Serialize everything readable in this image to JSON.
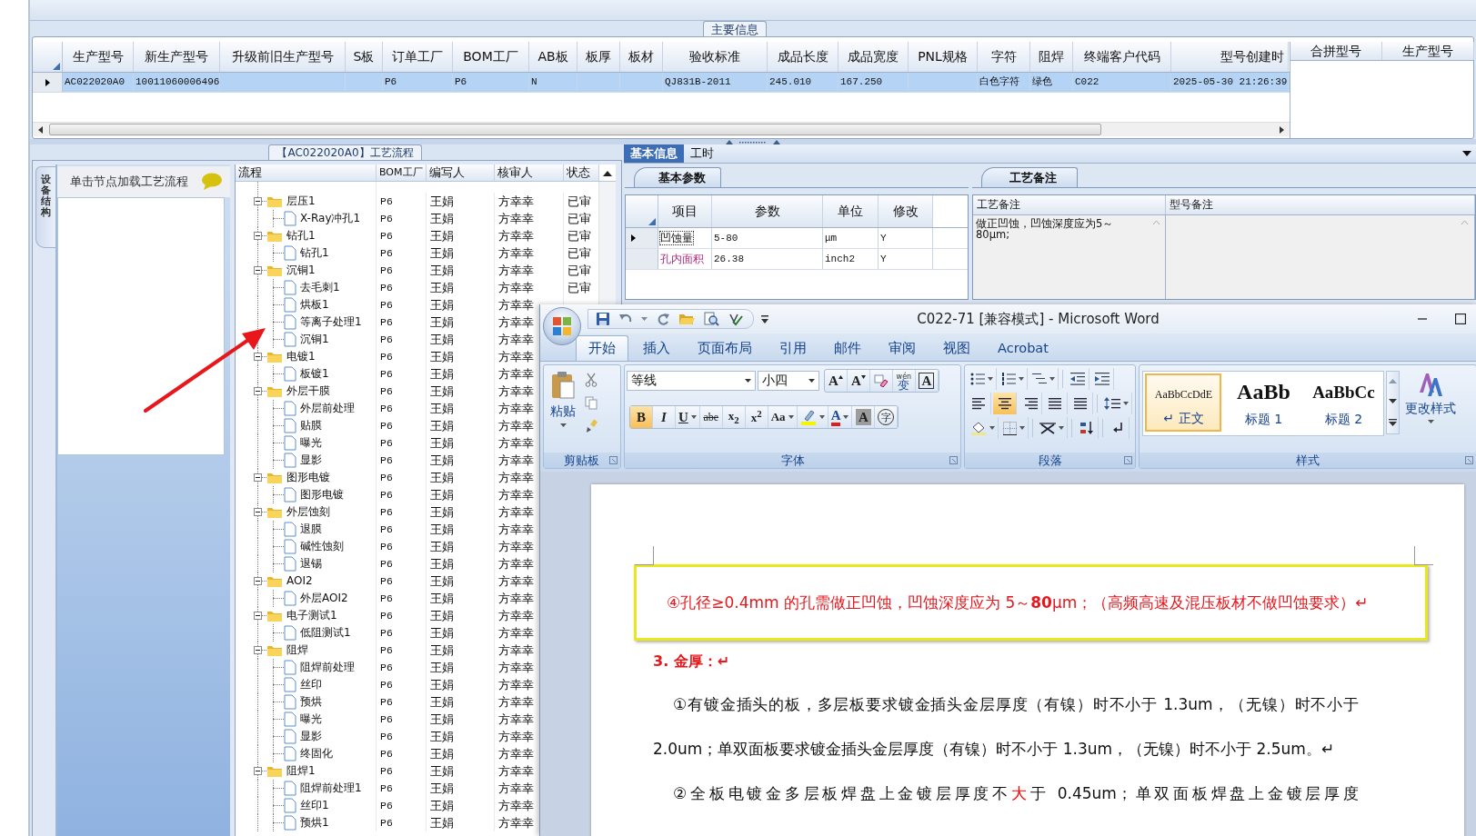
{
  "info_group": {
    "title": "主要信息",
    "row_selected": true,
    "columns": [
      {
        "label": "生产型号",
        "value": "AC022020A0"
      },
      {
        "label": "新生产型号",
        "value": "10011060006496"
      },
      {
        "label": "升级前旧生产型号"
      },
      {
        "label": "S板"
      },
      {
        "label": "订单工厂",
        "value": "P6"
      },
      {
        "label": "BOM工厂",
        "value": "P6"
      },
      {
        "label": "AB板",
        "value": "N"
      },
      {
        "label": "板厚"
      },
      {
        "label": "板材"
      },
      {
        "label": "验收标准",
        "value": "QJ831B-2011"
      },
      {
        "label": "成品长度",
        "value": "245.010"
      },
      {
        "label": "成品宽度",
        "value": "167.250"
      },
      {
        "label": "PNL规格"
      },
      {
        "label": "字符",
        "value": "白色字符"
      },
      {
        "label": "阻焊",
        "value": "绿色"
      },
      {
        "label": "终端客户代码",
        "value": "C022"
      },
      {
        "label": "型号创建时",
        "value": "2025-05-30 21:26:39"
      }
    ],
    "side_columns": [
      "合拼型号",
      "生产型号"
    ]
  },
  "flow": {
    "title": "【AC022020A0】工艺流程",
    "side_tab": "设备结构",
    "hint": "单击节点加载工艺流程",
    "columns": [
      "流程",
      "BOM工厂",
      "编写人",
      "核审人",
      "状态"
    ],
    "rows": [
      {
        "name": "层压1",
        "expanded": true,
        "bom": "P6",
        "writer": "王娟",
        "reviewer": "方幸幸",
        "status": "已审",
        "children": [
          {
            "name": "X-Ray冲孔1",
            "bom": "P6",
            "writer": "王娟",
            "reviewer": "方幸幸",
            "status": "已审"
          }
        ]
      },
      {
        "name": "钻孔1",
        "expanded": true,
        "bom": "P6",
        "writer": "王娟",
        "reviewer": "方幸幸",
        "status": "已审",
        "children": [
          {
            "name": "钻孔1",
            "bom": "P6",
            "writer": "王娟",
            "reviewer": "方幸幸",
            "status": "已审"
          }
        ]
      },
      {
        "name": "沉铜1",
        "expanded": true,
        "bom": "P6",
        "writer": "王娟",
        "reviewer": "方幸幸",
        "status": "已审",
        "children": [
          {
            "name": "去毛刺1",
            "bom": "P6",
            "writer": "王娟",
            "reviewer": "方幸幸",
            "status": "已审"
          },
          {
            "name": "烘板1",
            "bom": "P6",
            "writer": "王娟",
            "reviewer": "方幸幸"
          },
          {
            "name": "等离子处理1",
            "bom": "P6",
            "writer": "王娟",
            "reviewer": "方幸幸"
          },
          {
            "name": "沉铜1",
            "bom": "P6",
            "writer": "王娟",
            "reviewer": "方幸幸"
          }
        ]
      },
      {
        "name": "电镀1",
        "expanded": true,
        "bom": "P6",
        "writer": "王娟",
        "reviewer": "方幸幸",
        "children": [
          {
            "name": "板镀1",
            "bom": "P6",
            "writer": "王娟",
            "reviewer": "方幸幸"
          }
        ]
      },
      {
        "name": "外层干膜",
        "expanded": true,
        "bom": "P6",
        "writer": "王娟",
        "reviewer": "方幸幸",
        "children": [
          {
            "name": "外层前处理",
            "bom": "P6",
            "writer": "王娟",
            "reviewer": "方幸幸"
          },
          {
            "name": "贴膜",
            "bom": "P6",
            "writer": "王娟",
            "reviewer": "方幸幸"
          },
          {
            "name": "曝光",
            "bom": "P6",
            "writer": "王娟",
            "reviewer": "方幸幸"
          },
          {
            "name": "显影",
            "bom": "P6",
            "writer": "王娟",
            "reviewer": "方幸幸"
          }
        ]
      },
      {
        "name": "图形电镀",
        "expanded": true,
        "bom": "P6",
        "writer": "王娟",
        "reviewer": "方幸幸",
        "children": [
          {
            "name": "图形电镀",
            "bom": "P6",
            "writer": "王娟",
            "reviewer": "方幸幸"
          }
        ]
      },
      {
        "name": "外层蚀刻",
        "expanded": true,
        "bom": "P6",
        "writer": "王娟",
        "reviewer": "方幸幸",
        "children": [
          {
            "name": "退膜",
            "bom": "P6",
            "writer": "王娟",
            "reviewer": "方幸幸"
          },
          {
            "name": "碱性蚀刻",
            "bom": "P6",
            "writer": "王娟",
            "reviewer": "方幸幸"
          },
          {
            "name": "退锡",
            "bom": "P6",
            "writer": "王娟",
            "reviewer": "方幸幸"
          }
        ]
      },
      {
        "name": "AOI2",
        "expanded": true,
        "bom": "P6",
        "writer": "王娟",
        "reviewer": "方幸幸",
        "children": [
          {
            "name": "外层AOI2",
            "bom": "P6",
            "writer": "王娟",
            "reviewer": "方幸幸"
          }
        ]
      },
      {
        "name": "电子测试1",
        "expanded": true,
        "bom": "P6",
        "writer": "王娟",
        "reviewer": "方幸幸",
        "children": [
          {
            "name": "低阻测试1",
            "bom": "P6",
            "writer": "王娟",
            "reviewer": "方幸幸"
          }
        ]
      },
      {
        "name": "阻焊",
        "expanded": true,
        "bom": "P6",
        "writer": "王娟",
        "reviewer": "方幸幸",
        "children": [
          {
            "name": "阻焊前处理",
            "bom": "P6",
            "writer": "王娟",
            "reviewer": "方幸幸"
          },
          {
            "name": "丝印",
            "bom": "P6",
            "writer": "王娟",
            "reviewer": "方幸幸"
          },
          {
            "name": "预烘",
            "bom": "P6",
            "writer": "王娟",
            "reviewer": "方幸幸"
          },
          {
            "name": "曝光",
            "bom": "P6",
            "writer": "王娟",
            "reviewer": "方幸幸"
          },
          {
            "name": "显影",
            "bom": "P6",
            "writer": "王娟",
            "reviewer": "方幸幸"
          },
          {
            "name": "终固化",
            "bom": "P6",
            "writer": "王娟",
            "reviewer": "方幸幸"
          }
        ]
      },
      {
        "name": "阻焊1",
        "expanded": true,
        "bom": "P6",
        "writer": "王娟",
        "reviewer": "方幸幸",
        "children": [
          {
            "name": "阻焊前处理1",
            "bom": "P6",
            "writer": "王娟",
            "reviewer": "方幸幸"
          },
          {
            "name": "丝印1",
            "bom": "P6",
            "writer": "王娟",
            "reviewer": "方幸幸"
          },
          {
            "name": "预烘1",
            "bom": "P6",
            "writer": "王娟",
            "reviewer": "方幸幸"
          }
        ]
      }
    ]
  },
  "detail": {
    "tabs": [
      {
        "label": "基本信息",
        "selected": true
      },
      {
        "label": "工时",
        "selected": false
      }
    ],
    "params": {
      "tab": "基本参数",
      "columns": [
        "项目",
        "参数",
        "单位",
        "修改"
      ],
      "rows": [
        {
          "item": "凹蚀量",
          "value": "5-80",
          "unit": "μm",
          "edit": "Y",
          "selected": true,
          "emphasis": false
        },
        {
          "item": "孔内面积",
          "value": "26.38",
          "unit": "inch2",
          "edit": "Y",
          "selected": false,
          "emphasis": true
        }
      ]
    },
    "notes": {
      "tab": "工艺备注",
      "columns": [
        "工艺备注",
        "型号备注"
      ],
      "process_note": "做正凹蚀，凹蚀深度应为5～80μm;"
    }
  },
  "word": {
    "title": "C022-71 [兼容模式] - Microsoft Word",
    "tabs": [
      {
        "label": "开始",
        "selected": true
      },
      {
        "label": "插入",
        "selected": false
      },
      {
        "label": "页面布局",
        "selected": false
      },
      {
        "label": "引用",
        "selected": false
      },
      {
        "label": "邮件",
        "selected": false
      },
      {
        "label": "审阅",
        "selected": false
      },
      {
        "label": "视图",
        "selected": false
      },
      {
        "label": "Acrobat",
        "selected": false
      }
    ],
    "clipboard": {
      "paste": "粘贴",
      "label": "剪贴板"
    },
    "font": {
      "label": "字体",
      "name": "等线",
      "size": "小四",
      "row1": [
        {
          "kind": "grow",
          "text": "A"
        },
        {
          "kind": "shrink",
          "text": "A"
        },
        {
          "kind": "clear"
        },
        {
          "kind": "phonetic",
          "text": "变",
          "ruby": "wén"
        },
        {
          "kind": "border",
          "text": "A"
        }
      ],
      "row2": [
        {
          "kind": "bold",
          "text": "B",
          "selected": true
        },
        {
          "kind": "italic",
          "text": "I",
          "selected": false
        },
        {
          "kind": "underline",
          "text": "U",
          "selected": false
        },
        {
          "kind": "strike",
          "text": "abe",
          "selected": false
        },
        {
          "kind": "sub",
          "text": "x$_{2}$",
          "selected": false
        },
        {
          "kind": "sup",
          "text": "x$^{2}$",
          "selected": false
        },
        {
          "kind": "case",
          "text": "Aa",
          "selected": false
        },
        {
          "kind": "highlight",
          "selected": false
        },
        {
          "kind": "color",
          "text": "A",
          "selected": false
        },
        {
          "kind": "shade",
          "text": "A",
          "selected": false
        },
        {
          "kind": "enclose",
          "text": "字",
          "selected": false
        }
      ]
    },
    "paragraph": {
      "label": "段落",
      "align": [
        {
          "kind": "left",
          "selected": false
        },
        {
          "kind": "center",
          "selected": true
        },
        {
          "kind": "right",
          "selected": false
        },
        {
          "kind": "justify",
          "selected": false
        },
        {
          "kind": "distributed",
          "selected": false
        }
      ]
    },
    "styles": {
      "label": "样式",
      "change": "更改样式",
      "items": [
        {
          "kind": "normal",
          "sample": "AaBbCcDdE",
          "name": "↵ 正文",
          "selected": true
        },
        {
          "kind": "h1",
          "sample": "AaBb",
          "name": "标题 1",
          "selected": false
        },
        {
          "kind": "h2",
          "sample": "AaBbCc",
          "name": "标题 2",
          "selected": false
        }
      ]
    },
    "document": {
      "boxed": "④孔径≥0.4mm 的孔需做正凹蚀，凹蚀深度应为 5～**80**μm；（高频高速及混压板材不做凹蚀要求）↵",
      "heading": "3. 金厚：↵",
      "paragraphs": [
        {
          "kind": "normal",
          "segments": [
            {
              "text": "①有镀金插头的板，多层板要求镀金插头金层厚度（有镍）时不小于 1.3um，（无镍）时不小于 2.0um；单双面板要求镀金插头金层厚度（有镍）时不小于 1.3um，（无镍）时不小于 2.5um。↵",
              "emphasis": false
            }
          ]
        },
        {
          "kind": "justified",
          "segments": [
            {
              "text": "②全板电镀金多层板焊盘上金镀层厚度不",
              "emphasis": false
            },
            {
              "text": "大",
              "emphasis": true
            },
            {
              "text": "于 0.45um；单双面板焊盘上金镀层厚度",
              "emphasis": false
            }
          ]
        }
      ]
    }
  }
}
